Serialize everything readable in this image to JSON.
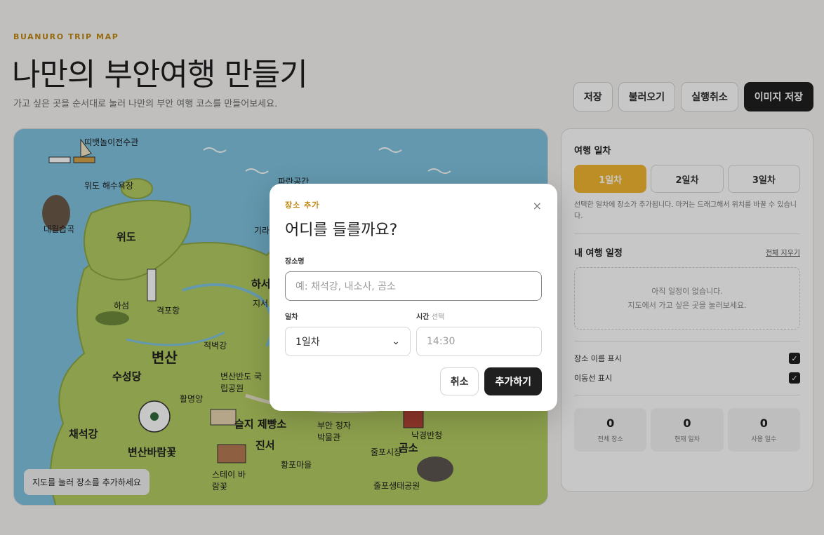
{
  "header": {
    "eyebrow": "BUANURO TRIP MAP",
    "title": "나만의 부안여행 만들기",
    "subtitle": "가고 싶은 곳을 순서대로 눌러 나만의 부안 여행 코스를 만들어보세요."
  },
  "toolbar": {
    "save": "저장",
    "load": "불러오기",
    "undo": "실행취소",
    "save_image": "이미지 저장"
  },
  "map": {
    "hint": "지도를 눌러 장소를 추가하세요",
    "labels": {
      "wido_festival": "띠뱃놀이전수관",
      "wido_beach": "위도 해수욕장",
      "daewol": "대월습곡",
      "wido": "위도",
      "hasum": "하섬",
      "gyeokpo": "격포항",
      "jeokbyeok": "적벽강",
      "byeonsan": "변산",
      "suseongdang": "수성당",
      "chaeseokgang": "채석강",
      "national_park": "변산반도 국립공원",
      "hwalryeong": "활명앙",
      "flower": "변산바람꽃",
      "bakery": "슬지 제빵소",
      "jinseo": "진서",
      "cheongja": "부안 청자 박물관",
      "gomso": "곰소",
      "stay": "스테이 바람꽃",
      "hwangpo": "황포마을",
      "paraeng": "파란공간",
      "harseo": "하서",
      "giran": "기라",
      "jisa": "지서",
      "julpo_market": "줄포시장",
      "julpo": "줄포",
      "julpo_park": "줄포생태공원",
      "nakyeong": "낙경반청"
    }
  },
  "panel": {
    "days_heading": "여행 일차",
    "days": [
      "1일차",
      "2일차",
      "3일차"
    ],
    "days_hint": "선택한 일차에 장소가 추가됩니다. 마커는 드래그해서 위치를 바꿀 수 있습니다.",
    "schedule_heading": "내 여행 일정",
    "clear_all": "전체 지우기",
    "empty_line1": "아직 일정이 없습니다.",
    "empty_line2": "지도에서 가고 싶은 곳을 눌러보세요.",
    "toggle_names": "장소 이름 표시",
    "toggle_routes": "이동선 표시",
    "check_mark": "✓",
    "stats": [
      {
        "value": "0",
        "label": "전체 장소"
      },
      {
        "value": "0",
        "label": "현재 일차"
      },
      {
        "value": "0",
        "label": "사용 일수"
      }
    ]
  },
  "modal": {
    "eyebrow": "장소 추가",
    "close": "×",
    "title": "어디를 들를까요?",
    "name_label": "장소명",
    "name_placeholder": "예: 채석강, 내소사, 곰소",
    "day_label": "일차",
    "day_value": "1일차",
    "day_chevron": "⌄",
    "time_label": "시간",
    "time_optional": "선택",
    "time_placeholder": "14:30",
    "cancel": "취소",
    "submit": "추가하기"
  },
  "colors": {
    "accent": "#f2b631",
    "sea": "#7fc3df",
    "land": "#b4cc62",
    "dark": "#1f1f1f"
  }
}
